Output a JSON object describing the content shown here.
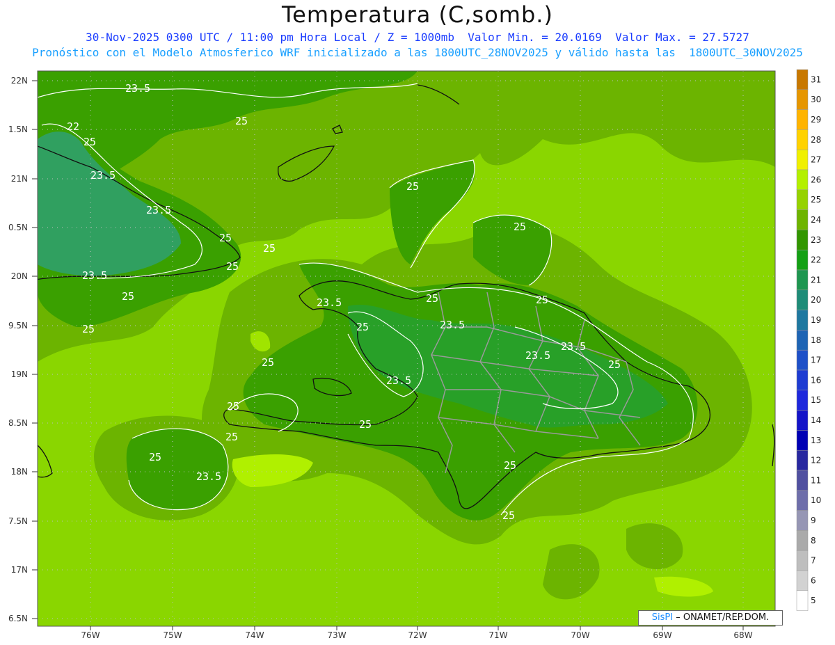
{
  "title": "Temperatura (C,somb.)",
  "subtitle1": "30-Nov-2025 0300 UTC / 11:00 pm Hora Local / Z = 1000mb  Valor Min. = 20.0169  Valor Max. = 27.5727",
  "subtitle2": "Pronóstico con el Modelo Atmosferico WRF inicializado a las 1800UTC_28NOV2025 y válido hasta las  1800UTC_30NOV2025",
  "credit_logo": "SisPI",
  "credit_text": "– ONAMET/REP.DOM.",
  "lat_labels": [
    "22N",
    "1.5N",
    "21N",
    "0.5N",
    "20N",
    "9.5N",
    "19N",
    "8.5N",
    "18N",
    "7.5N",
    "17N",
    "6.5N"
  ],
  "lon_labels": [
    "76W",
    "75W",
    "74W",
    "73W",
    "72W",
    "71W",
    "70W",
    "69W",
    "68W"
  ],
  "colorbar": {
    "levels": [
      "31",
      "30",
      "29",
      "28",
      "27",
      "26",
      "25",
      "24",
      "23",
      "22",
      "21",
      "20",
      "19",
      "18",
      "17",
      "16",
      "15",
      "14",
      "13",
      "12",
      "11",
      "10",
      "9",
      "8",
      "7",
      "6",
      "5"
    ],
    "colors": [
      "#c87800",
      "#e69600",
      "#ffb400",
      "#ffd200",
      "#f0f000",
      "#b4f000",
      "#96d200",
      "#6eb400",
      "#329600",
      "#14a014",
      "#1e9650",
      "#1e8c78",
      "#1e78a0",
      "#1e64b4",
      "#1e50c8",
      "#1e3cd2",
      "#1e28dc",
      "#1414c8",
      "#0000b4",
      "#2828a0",
      "#5050a0",
      "#6e6eaa",
      "#9696b4",
      "#aaaaaa",
      "#bebebe",
      "#d2d2d2",
      "#ffffff"
    ]
  },
  "contour_labels": [
    "23.5",
    "25",
    "22",
    "23.5",
    "23.5",
    "25",
    "23.5",
    "25",
    "25",
    "25",
    "25",
    "25",
    "25",
    "23.5",
    "25",
    "23.5",
    "23.5",
    "23.5",
    "25",
    "25",
    "25",
    "23.5",
    "25",
    "25",
    "25",
    "25",
    "25",
    "23.5",
    "25",
    "25",
    "25"
  ],
  "colors": {
    "background_light": "#8ad600",
    "medium": "#6cb400",
    "dark": "#3aa000",
    "darker": "#1e9614",
    "teal": "#30a060",
    "bright": "#b0f000",
    "subtitle_blue": "#1a3cff",
    "subtitle_cyan": "#1aa0ff"
  }
}
